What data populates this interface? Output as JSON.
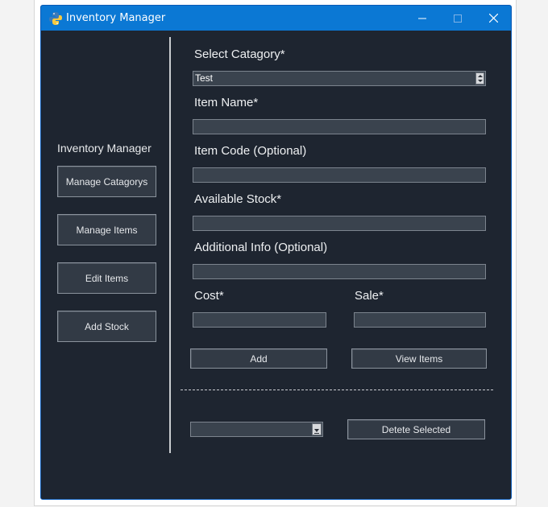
{
  "window": {
    "title": "Inventory Manager"
  },
  "sidebar": {
    "heading": "Inventory Manager",
    "buttons": {
      "manage_categories": "Manage Catagorys",
      "manage_items": "Manage Items",
      "edit_items": "Edit Items",
      "add_stock": "Add Stock"
    }
  },
  "form": {
    "category": {
      "label": "Select Catagory*",
      "value": "Test"
    },
    "item_name": {
      "label": "Item Name*",
      "value": ""
    },
    "item_code": {
      "label": "Item Code (Optional)",
      "value": ""
    },
    "available_stock": {
      "label": "Available Stock*",
      "value": ""
    },
    "additional_info": {
      "label": "Additional Info (Optional)",
      "value": ""
    },
    "cost": {
      "label": "Cost*",
      "value": ""
    },
    "sale": {
      "label": "Sale*",
      "value": ""
    },
    "add_button": "Add",
    "view_items_button": "View Items"
  },
  "bottom": {
    "selected_value": "",
    "delete_button": "Detete Selected"
  },
  "icons": {
    "app": "python-icon",
    "minimize": "minimize-icon",
    "maximize": "maximize-icon",
    "close": "close-icon"
  },
  "colors": {
    "titlebar": "#0b78d4",
    "background": "#1e2530",
    "button": "#323a45",
    "field": "#3a434e"
  }
}
